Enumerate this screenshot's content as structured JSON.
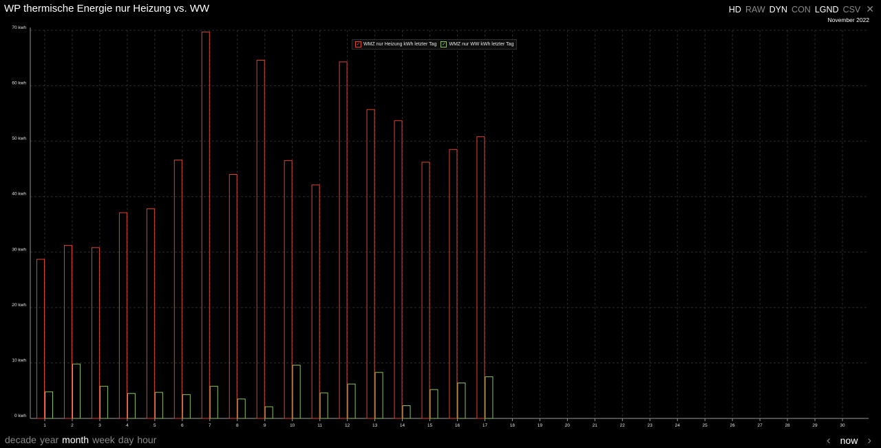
{
  "header": {
    "title": "WP thermische Energie nur Heizung vs. WW",
    "modes": [
      {
        "label": "HD",
        "active": true
      },
      {
        "label": "RAW",
        "active": false
      },
      {
        "label": "DYN",
        "active": true
      },
      {
        "label": "CON",
        "active": false
      },
      {
        "label": "LGND",
        "active": true
      },
      {
        "label": "CSV",
        "active": false
      }
    ],
    "close_icon": "close-icon",
    "period": "November 2022"
  },
  "footer": {
    "ranges": [
      {
        "label": "decade",
        "active": false
      },
      {
        "label": "year",
        "active": false
      },
      {
        "label": "month",
        "active": true
      },
      {
        "label": "week",
        "active": false
      },
      {
        "label": "day",
        "active": false
      },
      {
        "label": "hour",
        "active": false
      }
    ],
    "prev_icon": "chevron-left-icon",
    "now_label": "now",
    "next_icon": "chevron-right-icon"
  },
  "colors": {
    "background": "#000000",
    "heizung": "#e0442a",
    "ww": "#8fc35a",
    "grid": "#2c2c2c",
    "axis": "#9a9a9a"
  },
  "chart_data": {
    "type": "bar",
    "title": "WP thermische Energie nur Heizung vs. WW",
    "categories": [
      "1",
      "2",
      "3",
      "4",
      "5",
      "6",
      "7",
      "8",
      "9",
      "10",
      "11",
      "12",
      "13",
      "14",
      "15",
      "16",
      "17",
      "18",
      "19",
      "20",
      "21",
      "22",
      "23",
      "24",
      "25",
      "26",
      "27",
      "28",
      "29",
      "30"
    ],
    "yticks": [
      "0 kwh",
      "10 kwh",
      "20 kwh",
      "30 kwh",
      "40 kwh",
      "50 kwh",
      "60 kwh",
      "70 kwh"
    ],
    "ylim": [
      0,
      70
    ],
    "grid": true,
    "legend_position": "top-center",
    "series": [
      {
        "name": "WMZ nur Heizung kWh letzter Tag",
        "color": "#e0442a",
        "values": [
          28.7,
          31.2,
          30.8,
          37.1,
          37.8,
          46.6,
          69.7,
          44.0,
          64.6,
          46.5,
          42.1,
          64.3,
          55.7,
          53.7,
          46.2,
          48.5,
          50.8,
          null,
          null,
          null,
          null,
          null,
          null,
          null,
          null,
          null,
          null,
          null,
          null,
          null
        ]
      },
      {
        "name": "WMZ nur WW kWh letzter Tag",
        "color": "#8fc35a",
        "values": [
          4.8,
          9.8,
          5.8,
          4.5,
          4.7,
          4.3,
          5.8,
          3.5,
          2.1,
          9.6,
          4.6,
          6.2,
          8.3,
          2.3,
          5.2,
          6.4,
          7.5,
          null,
          null,
          null,
          null,
          null,
          null,
          null,
          null,
          null,
          null,
          null,
          null,
          null
        ]
      }
    ]
  }
}
